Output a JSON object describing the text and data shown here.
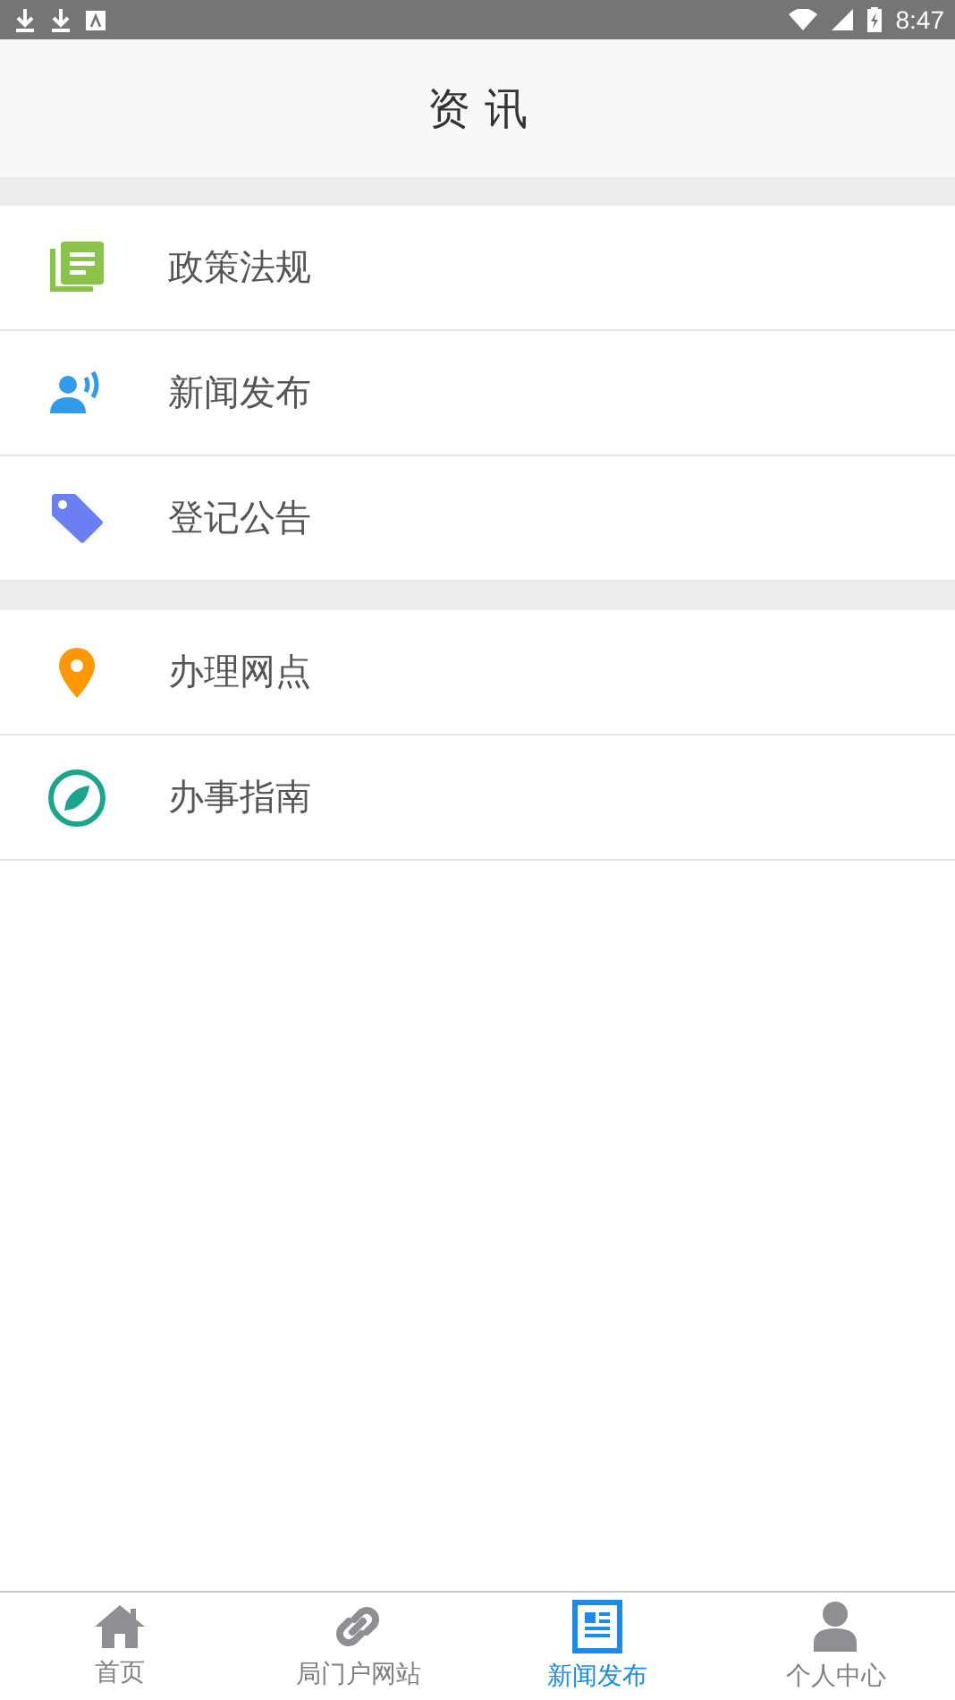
{
  "status_bar": {
    "time": "8:47"
  },
  "header": {
    "title": "资 讯"
  },
  "sections": [
    {
      "items": [
        {
          "label": "政策法规",
          "kind": "docs"
        },
        {
          "label": "新闻发布",
          "kind": "speaker"
        },
        {
          "label": "登记公告",
          "kind": "tag"
        }
      ]
    },
    {
      "items": [
        {
          "label": "办理网点",
          "kind": "pin"
        },
        {
          "label": "办事指南",
          "kind": "compass"
        }
      ]
    }
  ],
  "tab_bar": [
    {
      "label": "首页",
      "kind": "home",
      "selected": false
    },
    {
      "label": "局门户网站",
      "kind": "link",
      "selected": false
    },
    {
      "label": "新闻发布",
      "kind": "news",
      "selected": true
    },
    {
      "label": "个人中心",
      "kind": "person",
      "selected": false
    }
  ]
}
